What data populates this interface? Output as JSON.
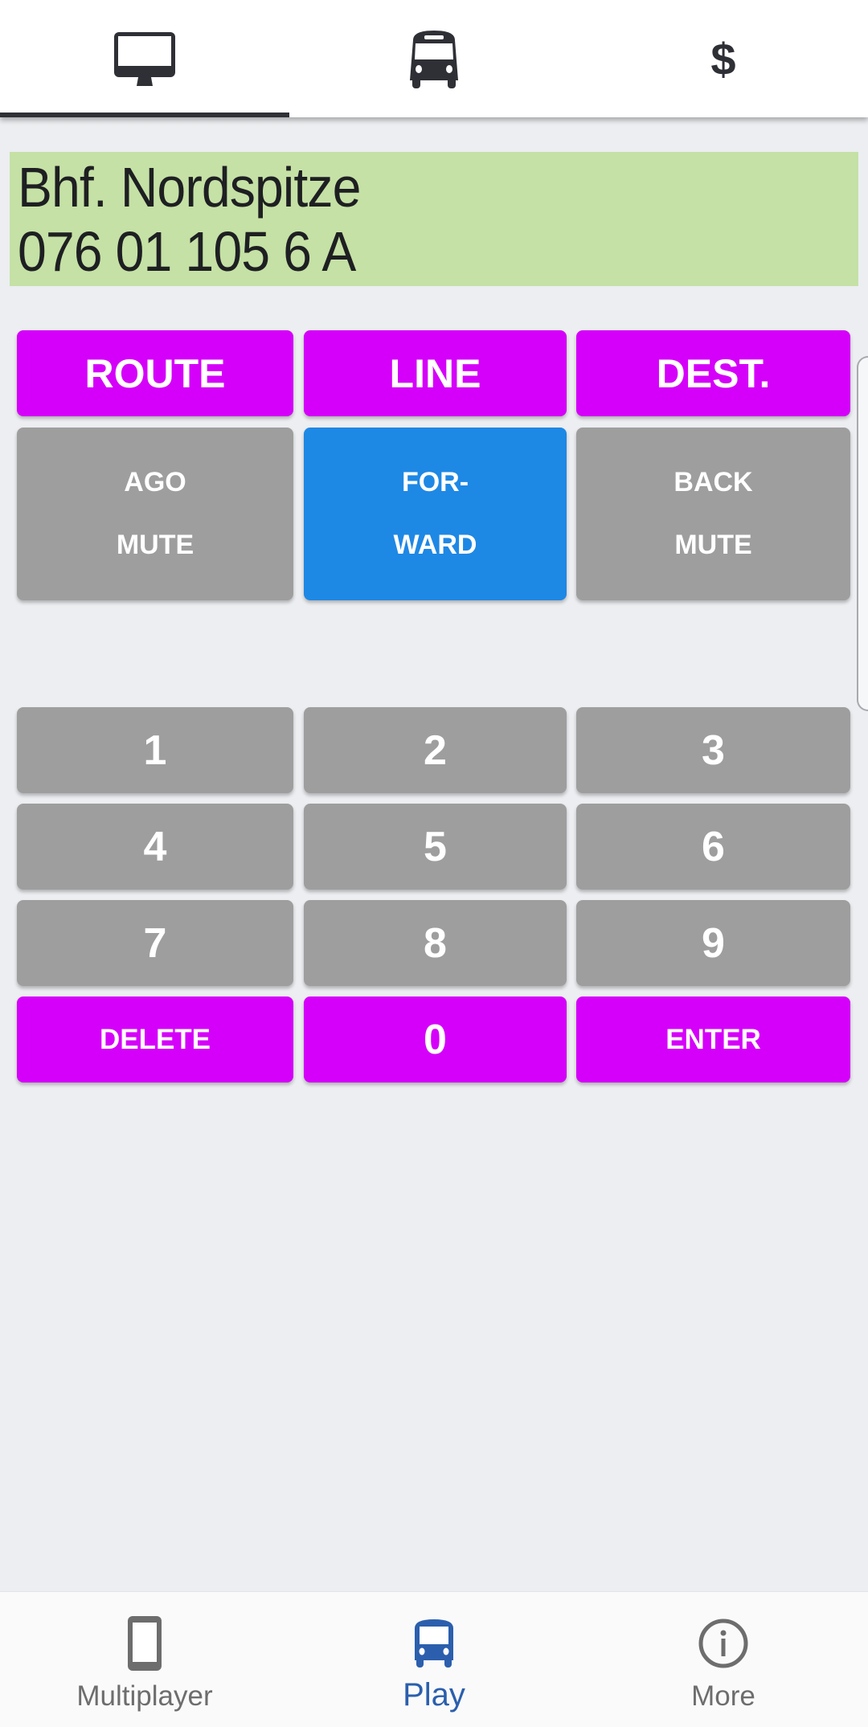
{
  "top_tabs": [
    {
      "name": "display",
      "icon": "monitor-icon",
      "active": true
    },
    {
      "name": "bus",
      "icon": "bus-icon",
      "active": false
    },
    {
      "name": "money",
      "icon": "dollar-icon",
      "active": false
    }
  ],
  "display": {
    "line1": "Bhf. Nordspitze",
    "line2": "076 01 105 6 A",
    "background": "#c5e1a5"
  },
  "function_buttons": {
    "route": "ROUTE",
    "line": "LINE",
    "dest": "DEST."
  },
  "mode_buttons": [
    {
      "line1": "AGO",
      "line2": "MUTE",
      "active": false
    },
    {
      "line1": "FOR-",
      "line2": "WARD",
      "active": true
    },
    {
      "line1": "BACK",
      "line2": "MUTE",
      "active": false
    }
  ],
  "numpad": {
    "keys": [
      "1",
      "2",
      "3",
      "4",
      "5",
      "6",
      "7",
      "8",
      "9"
    ],
    "delete": "DELETE",
    "zero": "0",
    "enter": "ENTER"
  },
  "bottom_nav": [
    {
      "label": "Multiplayer",
      "icon": "phone-icon",
      "active": false
    },
    {
      "label": "Play",
      "icon": "bus-icon",
      "active": true
    },
    {
      "label": "More",
      "icon": "info-icon",
      "active": false
    }
  ],
  "colors": {
    "magenta": "#d500f9",
    "gray": "#9e9e9e",
    "blue": "#1e88e5",
    "nav_active": "#2b5fad",
    "nav_inactive": "#6d6d6d"
  }
}
